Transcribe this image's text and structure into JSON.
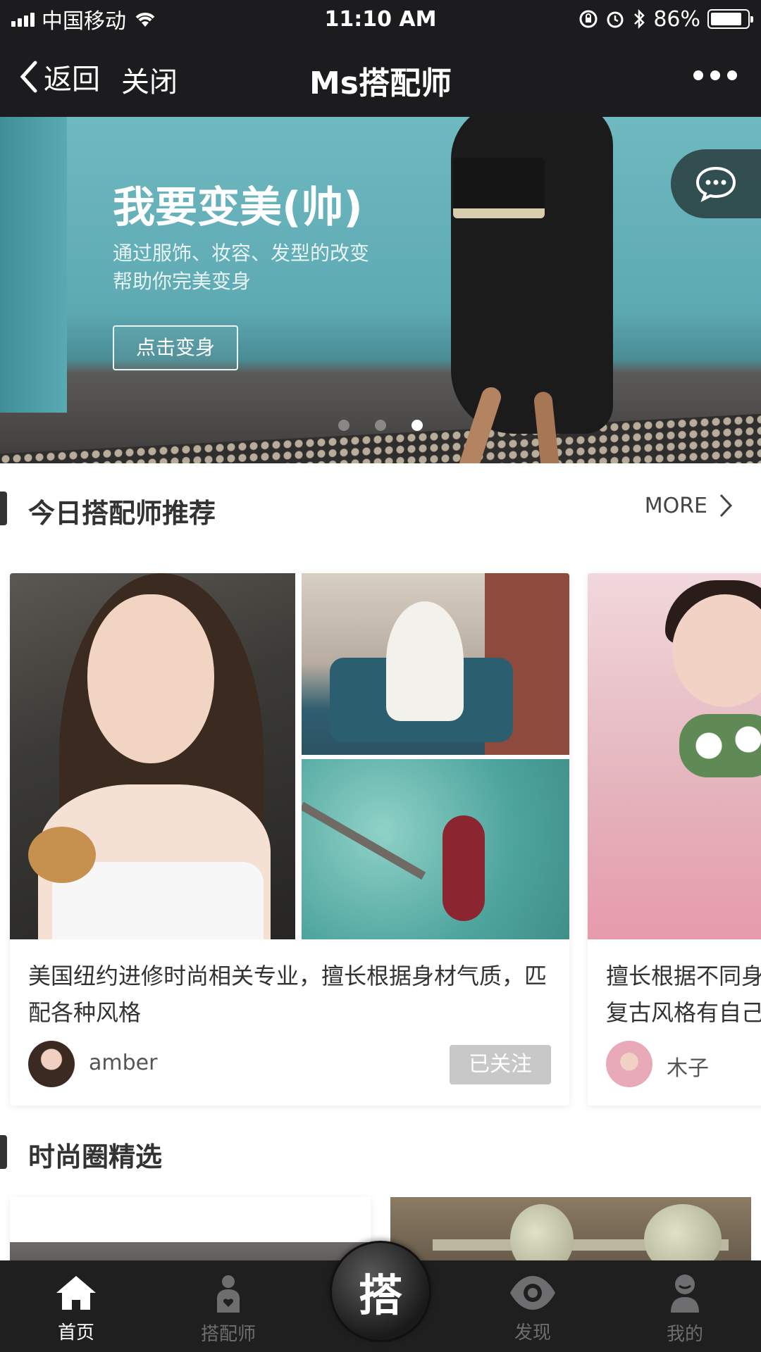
{
  "status_bar": {
    "carrier": "中国移动",
    "time": "11:10 AM",
    "battery": "86%",
    "battery_level": 0.86
  },
  "nav": {
    "back_label": "返回",
    "close_label": "关闭",
    "title": "Ms搭配师"
  },
  "banner": {
    "title": "我要变美(帅)",
    "subtitle_line1": "通过服饰、妆容、发型的改变",
    "subtitle_line2": "帮助你完美变身",
    "button_label": "点击变身",
    "slide_count": 3,
    "active_slide": 3
  },
  "recommend": {
    "title": "今日搭配师推荐",
    "more_label": "MORE",
    "cards": [
      {
        "description": "美国纽约进修时尚相关专业，擅长根据身材气质，匹配各种风格",
        "author": "amber",
        "follow_label": "已关注"
      },
      {
        "description": "擅长根据不同身复古风格有自己",
        "description_line1": "擅长根据不同身",
        "description_line2": "复古风格有自己",
        "author": "木子"
      }
    ]
  },
  "fashion_circle": {
    "title": "时尚圈精选"
  },
  "tab_bar": {
    "tabs": [
      {
        "label": "首页",
        "icon": "home-icon",
        "active": true
      },
      {
        "label": "搭配师",
        "icon": "stylist-icon",
        "active": false
      },
      {
        "label": "发现",
        "icon": "eye-icon",
        "active": false
      },
      {
        "label": "我的",
        "icon": "profile-icon",
        "active": false
      }
    ],
    "center_label": "搭"
  },
  "colors": {
    "bar_background": "#1c1c1e",
    "tab_active": "#ffffff",
    "tab_inactive": "#6e6e70",
    "follow_button": "#c8c8c8"
  }
}
